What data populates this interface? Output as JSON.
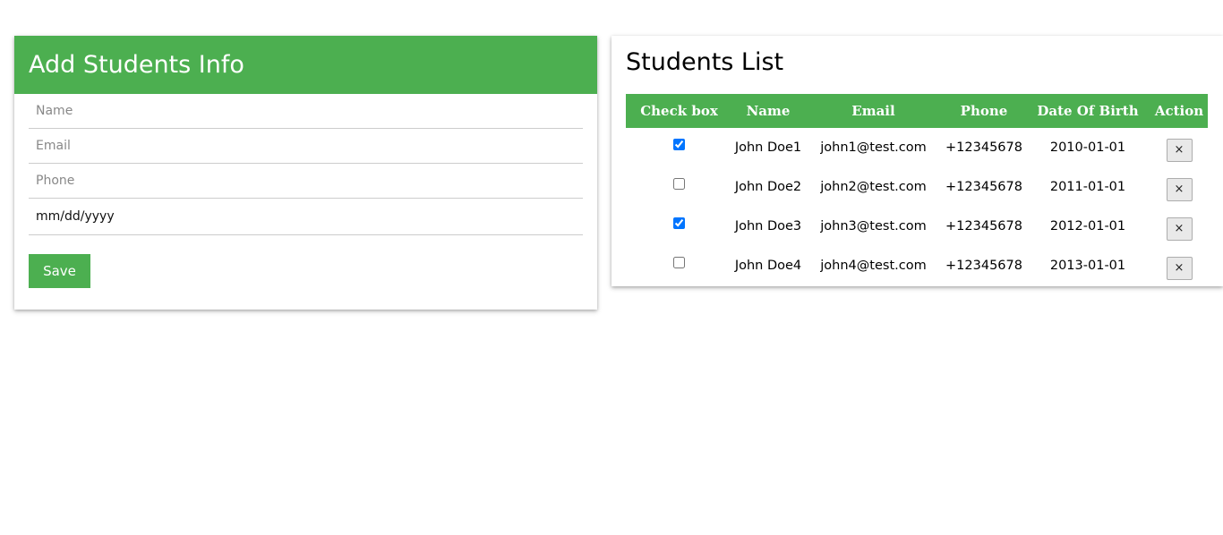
{
  "form": {
    "title": "Add Students Info",
    "name_placeholder": "Name",
    "email_placeholder": "Email",
    "phone_placeholder": "Phone",
    "dob_value": "mm/dd/yyyy",
    "save_label": "Save"
  },
  "list": {
    "title": "Students List",
    "columns": [
      "Check box",
      "Name",
      "Email",
      "Phone",
      "Date Of Birth",
      "Action"
    ],
    "rows": [
      {
        "checked": true,
        "name": "John Doe1",
        "email": "john1@test.com",
        "phone": "+12345678",
        "dob": "2010-01-01",
        "action": "×"
      },
      {
        "checked": false,
        "name": "John Doe2",
        "email": "john2@test.com",
        "phone": "+12345678",
        "dob": "2011-01-01",
        "action": "×"
      },
      {
        "checked": true,
        "name": "John Doe3",
        "email": "john3@test.com",
        "phone": "+12345678",
        "dob": "2012-01-01",
        "action": "×"
      },
      {
        "checked": false,
        "name": "John Doe4",
        "email": "john4@test.com",
        "phone": "+12345678",
        "dob": "2013-01-01",
        "action": "×"
      }
    ]
  },
  "colors": {
    "accent": "#4caf50"
  }
}
